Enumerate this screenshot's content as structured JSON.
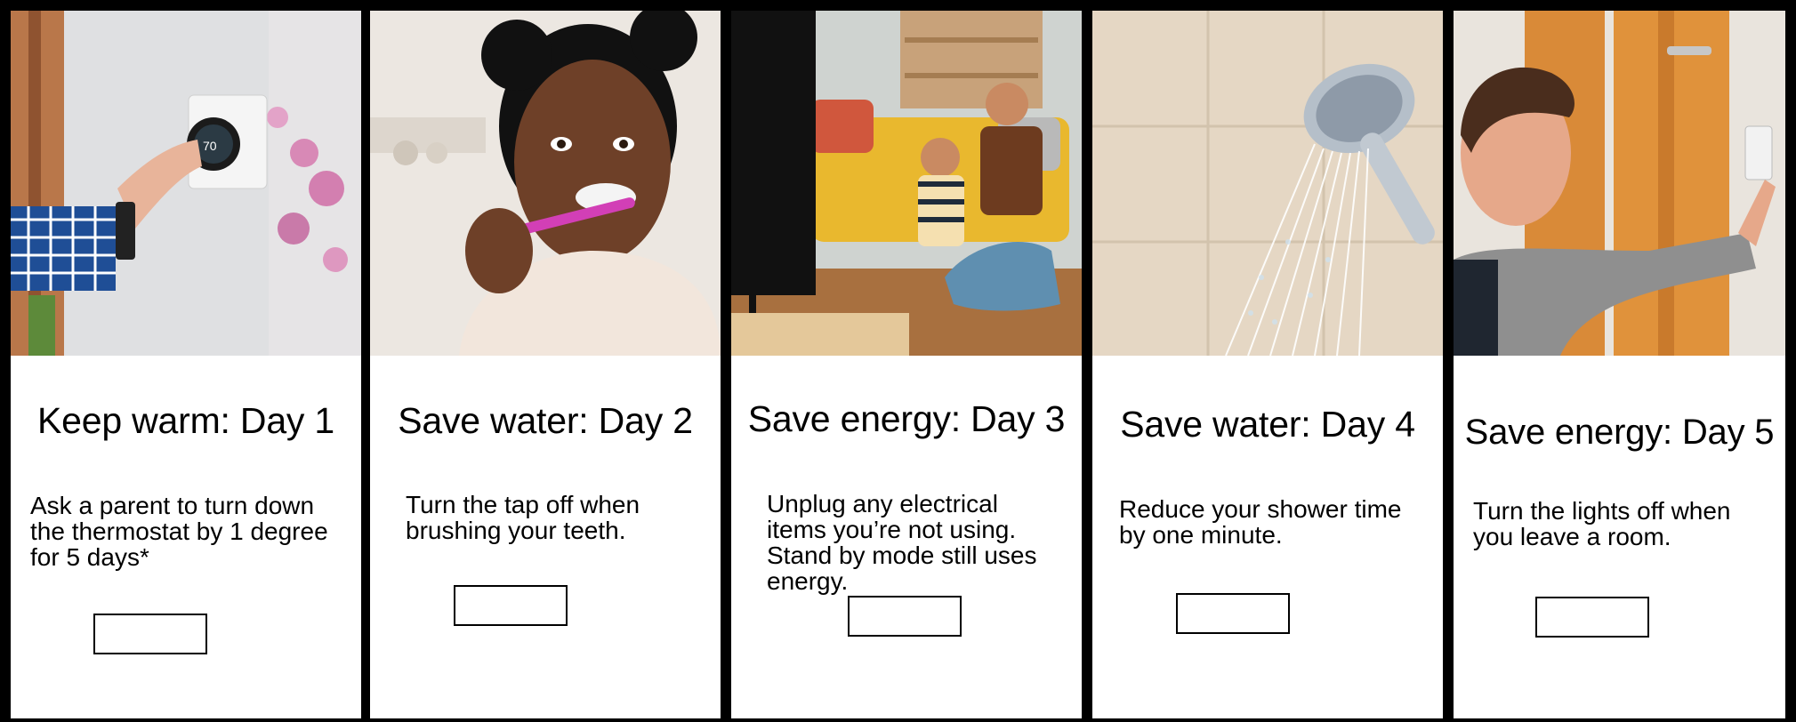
{
  "cards": [
    {
      "title": "Keep warm: Day 1",
      "description": "Ask a parent to turn down the thermostat by 1 degree for 5 days*",
      "image_alt": "hand adjusting wall thermostat",
      "thermostat_reading": "70",
      "icon": "thermostat-photo"
    },
    {
      "title": "Save water: Day 2",
      "description": "Turn the tap off when brushing your teeth.",
      "image_alt": "girl brushing teeth",
      "icon": "toothbrush-photo"
    },
    {
      "title": "Save energy: Day 3",
      "description": "Unplug any electrical items you’re not using. Stand by mode still uses energy.",
      "image_alt": "father and child playing video games",
      "icon": "tv-gaming-photo"
    },
    {
      "title": "Save water: Day 4",
      "description": "Reduce your shower time by one minute.",
      "image_alt": "running shower head",
      "icon": "shower-photo"
    },
    {
      "title": "Save energy: Day 5",
      "description": "Turn the lights off when you leave a room.",
      "image_alt": "boy switching off light",
      "icon": "light-switch-photo"
    }
  ],
  "colors": {
    "frame": "#000000",
    "card_background": "#ffffff",
    "text": "#000000"
  }
}
